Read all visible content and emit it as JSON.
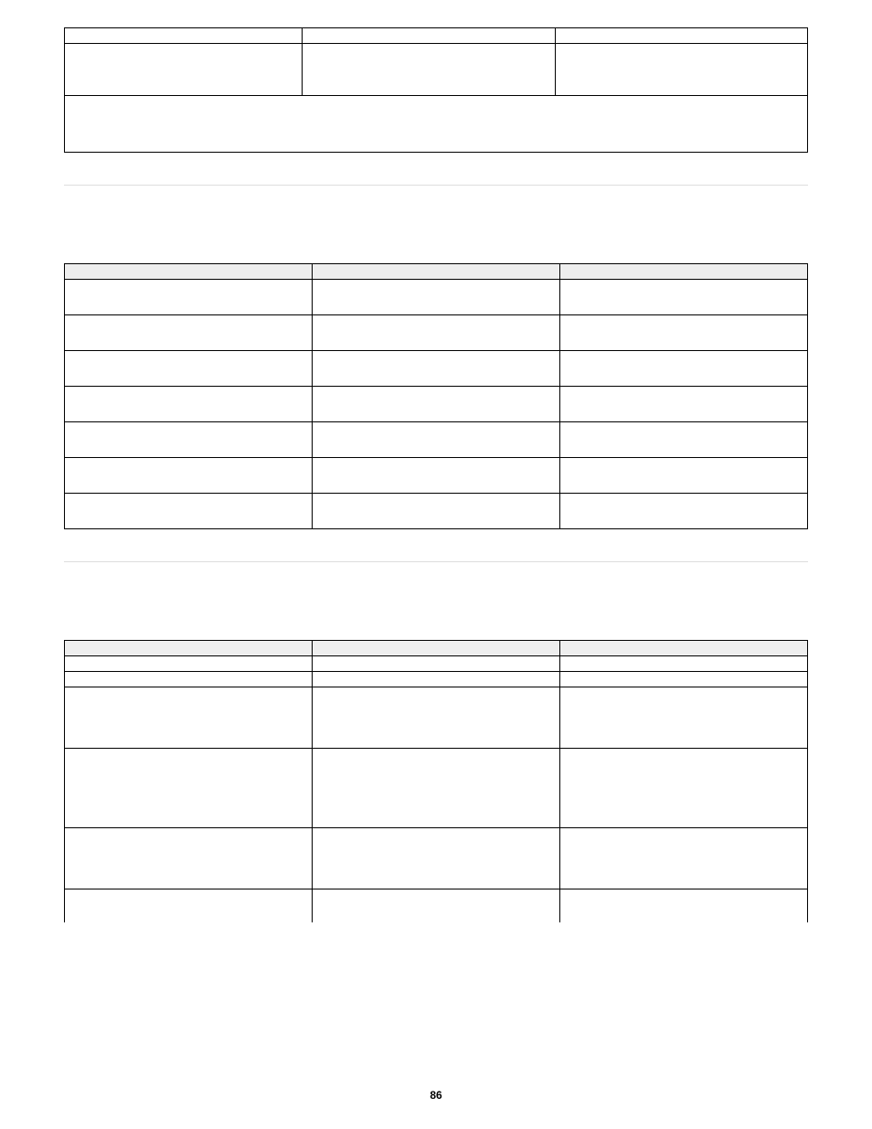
{
  "page_number": "86",
  "table1_fragment": {
    "rows": [
      [
        "",
        "",
        ""
      ],
      [
        "",
        "",
        ""
      ]
    ],
    "footer_row": [
      ""
    ]
  },
  "table2": {
    "headers": [
      "",
      "",
      ""
    ],
    "rows": [
      [
        "",
        "",
        ""
      ],
      [
        "",
        "",
        ""
      ],
      [
        "",
        "",
        ""
      ],
      [
        "",
        "",
        ""
      ],
      [
        "",
        "",
        ""
      ],
      [
        "",
        "",
        ""
      ],
      [
        "",
        "",
        ""
      ]
    ]
  },
  "table3": {
    "headers": [
      "",
      "",
      ""
    ],
    "rows": [
      [
        "",
        "",
        ""
      ],
      [
        "",
        "",
        ""
      ],
      [
        "",
        "",
        ""
      ],
      [
        "",
        "",
        ""
      ],
      [
        "",
        "",
        ""
      ],
      [
        "",
        "",
        ""
      ]
    ]
  }
}
